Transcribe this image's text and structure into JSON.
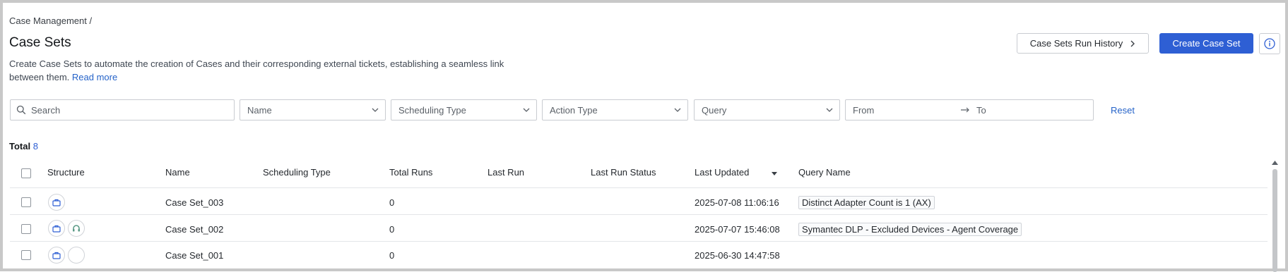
{
  "breadcrumb": "Case Management /",
  "page_title": "Case Sets",
  "description": "Create Case Sets to automate the creation of Cases and their corresponding external tickets, establishing a seamless link between them.",
  "read_more": "Read more",
  "header": {
    "run_history_label": "Case Sets Run History",
    "create_label": "Create Case Set"
  },
  "filters": {
    "search_placeholder": "Search",
    "name": "Name",
    "scheduling_type": "Scheduling Type",
    "action_type": "Action Type",
    "query": "Query",
    "from": "From",
    "to": "To",
    "reset": "Reset"
  },
  "total": {
    "label": "Total",
    "count": "8"
  },
  "columns": {
    "structure": "Structure",
    "name": "Name",
    "scheduling_type": "Scheduling Type",
    "total_runs": "Total Runs",
    "last_run": "Last Run",
    "last_run_status": "Last Run Status",
    "last_updated": "Last Updated",
    "query_name": "Query Name"
  },
  "rows": [
    {
      "name": "Case Set_003",
      "total_runs": "0",
      "last_updated": "2025-07-08 11:06:16",
      "query_name": "Distinct Adapter Count is 1 (AX)",
      "structure_icons": [
        "briefcase-icon"
      ]
    },
    {
      "name": "Case Set_002",
      "total_runs": "0",
      "last_updated": "2025-07-07 15:46:08",
      "query_name": "Symantec DLP - Excluded Devices - Agent Coverage",
      "structure_icons": [
        "briefcase-icon",
        "headset-icon"
      ]
    },
    {
      "name": "Case Set_001",
      "total_runs": "0",
      "last_updated": "2025-06-30 14:47:58",
      "query_name": "",
      "structure_icons": [
        "briefcase-icon",
        "empty-icon"
      ]
    }
  ],
  "colors": {
    "primary": "#2e5fd4",
    "link": "#2563c9",
    "icon_teal": "#5a9a86"
  }
}
